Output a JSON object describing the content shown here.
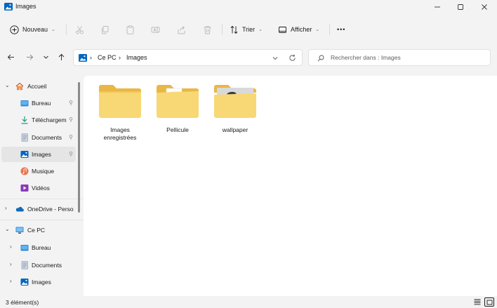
{
  "window": {
    "title": "Images",
    "icon": "images-folder-icon",
    "controls": [
      "minimize-icon",
      "maximize-icon",
      "close-icon"
    ]
  },
  "toolbar": {
    "new_label": "Nouveau",
    "sort_label": "Trier",
    "view_label": "Afficher",
    "more_label": "•••",
    "actions": [
      "cut-icon",
      "copy-icon",
      "paste-icon",
      "rename-icon",
      "share-icon",
      "delete-icon"
    ]
  },
  "address": {
    "breadcrumbs": [
      "Ce PC",
      "Images"
    ],
    "separator": "›"
  },
  "search": {
    "placeholder": "Rechercher dans : Images"
  },
  "sidebar": {
    "items": [
      {
        "label": "Accueil",
        "icon": "home-icon",
        "level": 0,
        "expanded": true
      },
      {
        "label": "Bureau",
        "icon": "desktop-icon",
        "level": 1,
        "pinned": true
      },
      {
        "label": "Téléchargem",
        "icon": "download-icon",
        "level": 1,
        "pinned": true
      },
      {
        "label": "Documents",
        "icon": "documents-icon",
        "level": 1,
        "pinned": true
      },
      {
        "label": "Images",
        "icon": "pictures-icon",
        "level": 1,
        "pinned": true,
        "selected": true
      },
      {
        "label": "Musique",
        "icon": "music-icon",
        "level": 1
      },
      {
        "label": "Vidéos",
        "icon": "videos-icon",
        "level": 1
      },
      {
        "label": "OneDrive - Perso",
        "icon": "onedrive-icon",
        "level": 0,
        "expanded": false
      },
      {
        "label": "Ce PC",
        "icon": "this-pc-icon",
        "level": 0,
        "expanded": true
      },
      {
        "label": "Bureau",
        "icon": "desktop-icon",
        "level": 1,
        "expanded": false
      },
      {
        "label": "Documents",
        "icon": "documents-icon",
        "level": 1,
        "expanded": false
      },
      {
        "label": "Images",
        "icon": "pictures-icon",
        "level": 1,
        "expanded": false
      }
    ]
  },
  "content": {
    "folders": [
      {
        "name": "Images enregistrées",
        "icon": "folder-icon"
      },
      {
        "name": "Pellicule",
        "icon": "folder-with-preview-icon"
      },
      {
        "name": "wallpaper",
        "icon": "folder-with-image-preview-icon"
      }
    ]
  },
  "status": {
    "item_count": "3 élément(s)"
  },
  "colors": {
    "accent": "#0067c0",
    "folder": "#f8d775",
    "folder_back": "#e9b744",
    "window_bg": "#f3f3f3",
    "content_bg": "#ffffff",
    "selected_bg": "#e5e5e5"
  }
}
